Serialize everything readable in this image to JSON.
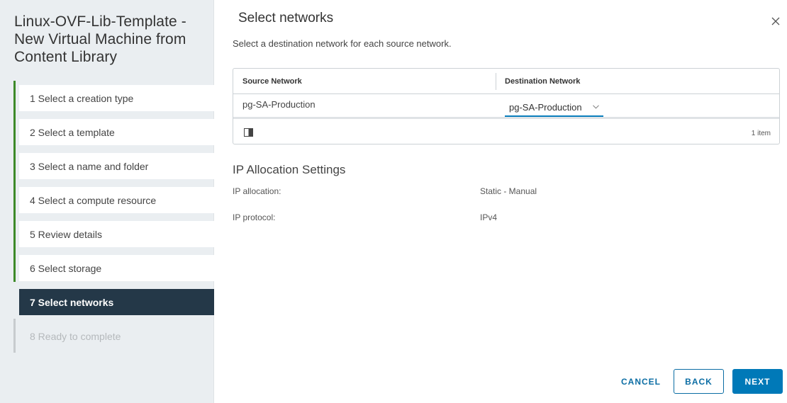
{
  "wizard": {
    "title": "Linux-OVF-Lib-Template - New Virtual Machine from Content Library",
    "steps": [
      {
        "label": "1  Select a creation type",
        "state": "done"
      },
      {
        "label": "2  Select a template",
        "state": "done"
      },
      {
        "label": "3  Select a name and folder",
        "state": "done"
      },
      {
        "label": "4  Select a compute resource",
        "state": "done"
      },
      {
        "label": "5  Review details",
        "state": "done"
      },
      {
        "label": "6  Select storage",
        "state": "done"
      },
      {
        "label": "7  Select networks",
        "state": "active"
      },
      {
        "label": "8  Ready to complete",
        "state": "disabled"
      }
    ]
  },
  "page": {
    "title": "Select networks",
    "subtitle": "Select a destination network for each source network.",
    "close_icon": "close-icon"
  },
  "network_grid": {
    "headers": [
      "Source Network",
      "Destination Network"
    ],
    "rows": [
      {
        "source": "pg-SA-Production",
        "destination": "pg-SA-Production"
      }
    ],
    "footer_count": "1 item"
  },
  "ip_allocation": {
    "title": "IP Allocation Settings",
    "fields": [
      {
        "label": "IP allocation:",
        "value": "Static - Manual"
      },
      {
        "label": "IP protocol:",
        "value": "IPv4"
      }
    ]
  },
  "buttons": {
    "cancel": "CANCEL",
    "back": "BACK",
    "next": "NEXT"
  },
  "colors": {
    "completed_rail": "#3d8a29",
    "active_step_bg": "#243848",
    "primary": "#0079b8"
  }
}
